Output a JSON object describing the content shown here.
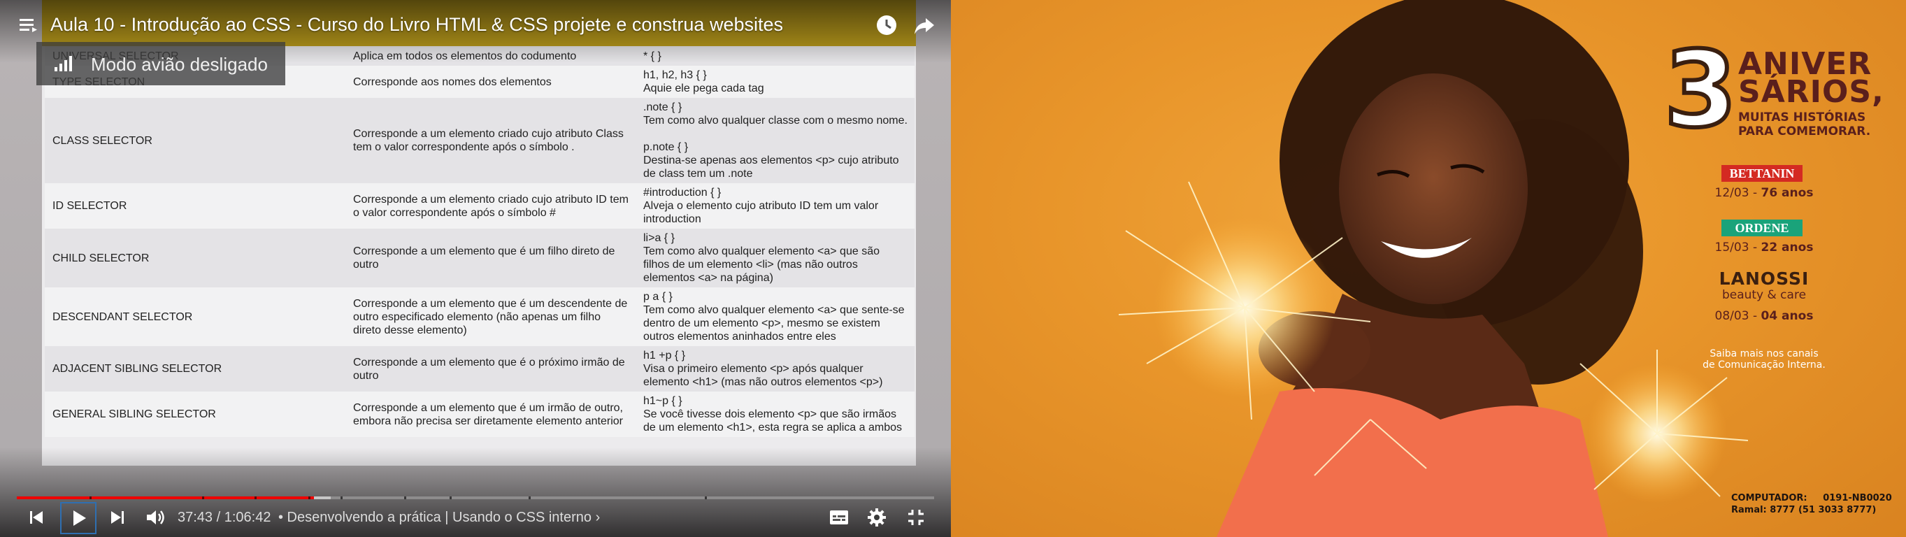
{
  "player": {
    "title": "Aula 10 - Introdução ao CSS - Curso do Livro HTML & CSS projete e construa websites",
    "airplane_toast": "Modo avião desligado",
    "time": "37:43 / 1:06:42",
    "chapter": "• Desenvolvendo a prática | Usando o CSS interno ›",
    "progress": {
      "played": 0.324,
      "buffered": 0.342,
      "chapter_marks": [
        0.079,
        0.202,
        0.259,
        0.318,
        0.353,
        0.422,
        0.472,
        0.558,
        0.75
      ]
    },
    "icons": {
      "menu": "menu-icon",
      "watch_later": "clock-icon",
      "share": "share-icon",
      "prev": "skip-previous-icon",
      "play": "play-icon",
      "next": "skip-next-icon",
      "volume": "volume-icon",
      "subtitles": "subtitles-icon",
      "settings": "gear-icon",
      "fullscreen_exit": "fullscreen-exit-icon",
      "signal": "signal-icon"
    },
    "accent": "#ff0000"
  },
  "slide": {
    "rows": [
      {
        "name": "UNIVERSAL SELECTOR",
        "desc": "Aplica em todos os elementos do codumento",
        "example": "* { }"
      },
      {
        "name": "TYPE SELECTON",
        "desc": "Corresponde aos nomes dos elementos",
        "example": "h1, h2, h3 { }\nAquie ele pega cada tag"
      },
      {
        "name": "CLASS SELECTOR",
        "desc": "Corresponde a um elemento criado cujo atributo Class tem o valor correspondente após o símbolo .",
        "example": ".note { }\nTem como alvo qualquer classe com o mesmo nome.\n\np.note { }\nDestina-se apenas aos elementos <p> cujo atributo de class tem um  .note"
      },
      {
        "name": "ID SELECTOR",
        "desc": "Corresponde a um elemento criado cujo atributo ID tem o valor correspondente após o símbolo #",
        "example": "#introduction { }\nAlveja o elemento cujo atributo ID tem um valor introduction"
      },
      {
        "name": "CHILD SELECTOR",
        "desc": "Corresponde a um elemento que é um filho direto de outro",
        "example": "li>a { }\nTem como alvo qualquer elemento <a> que são filhos de um elemento <li> (mas não outros elementos <a> na página)"
      },
      {
        "name": "DESCENDANT SELECTOR",
        "desc": "Corresponde a um elemento que é um descendente de outro especificado elemento (não apenas um filho direto desse elemento)",
        "example": "p a { }\nTem como alvo qualquer elemento <a> que sente-se dentro de um elemento <p>, mesmo se existem outros elementos aninhados entre eles"
      },
      {
        "name": "ADJACENT SIBLING SELECTOR",
        "desc": "Corresponde a um elemento que é o próximo irmão de outro",
        "example": "h1 +p { }\nVisa o primeiro elemento <p> após qualquer elemento <h1> (mas não outros elementos <p>)"
      },
      {
        "name": "GENERAL SIBLING SELECTOR",
        "desc": "Corresponde a um elemento que é um irmão de outro, embora não precisa ser diretamente elemento anterior",
        "example": "h1~p { }\nSe você tivesse dois elemento <p> que são irmãos de um elemento <h1>, esta regra se aplica a ambos"
      }
    ]
  },
  "poster": {
    "number": "3",
    "headline_1": "ANIVER",
    "headline_2": "SÁRIOS,",
    "subline_1": "MUITAS HISTÓRIAS",
    "subline_2": "PARA COMEMORAR.",
    "brands": {
      "bettanin": {
        "name": "BETTANIN",
        "date": "12/03 -",
        "years": "76 anos",
        "color": "#d42a22"
      },
      "ordene": {
        "name": "ORDENE",
        "date": "15/03 -",
        "years": "22 anos",
        "color": "#1aa37a"
      },
      "lanossi": {
        "name": "LANOSSI",
        "sub": "beauty & care",
        "date": "08/03 -",
        "years": "04 anos"
      }
    },
    "info_1": "Saiba mais nos canais",
    "info_2": "de Comunicação Interna.",
    "footer_1": "COMPUTADOR:     0191-NB0020",
    "footer_2": "Ramal: 8777 (51 3033 8777)"
  }
}
